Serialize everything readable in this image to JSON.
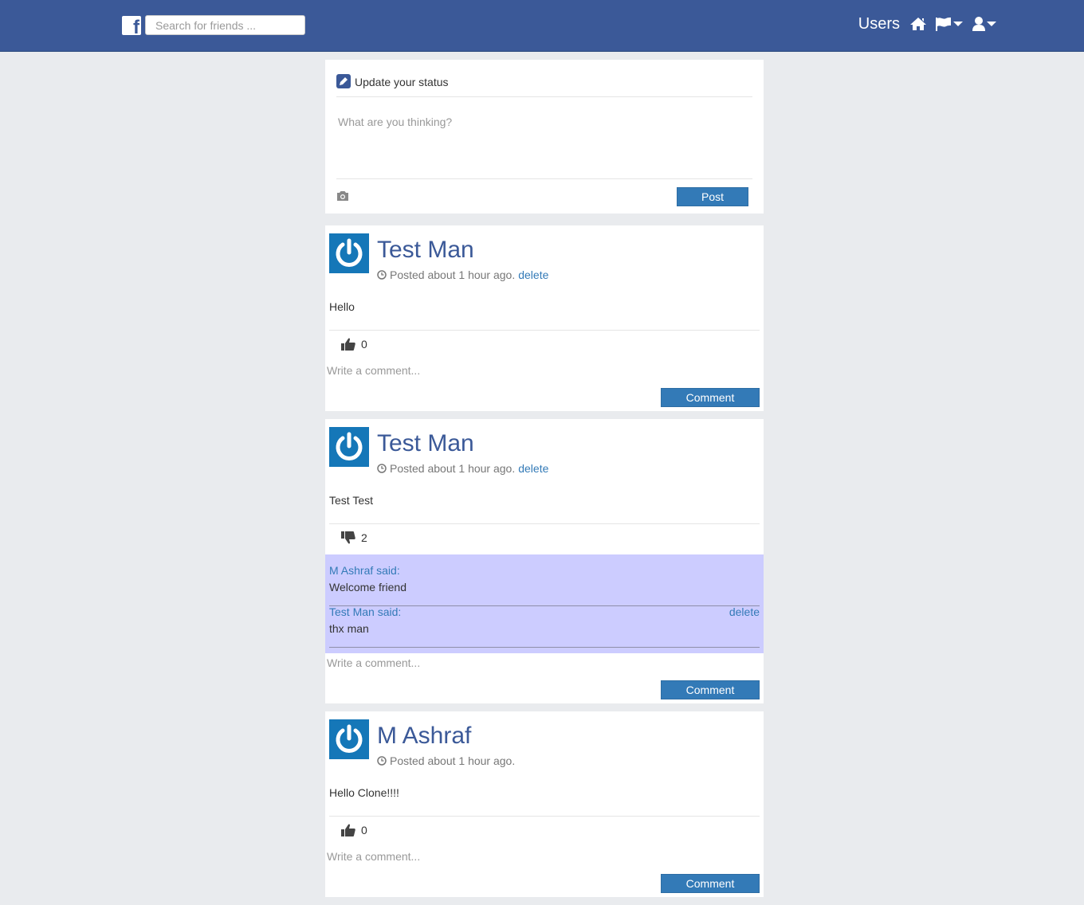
{
  "header": {
    "search_placeholder": "Search for friends ...",
    "users_label": "Users"
  },
  "composer": {
    "title": "Update your status",
    "placeholder": "What are you thinking?",
    "post_label": "Post"
  },
  "posts": [
    {
      "author": "Test Man",
      "meta": "Posted about 1 hour ago.",
      "delete_label": "delete",
      "body": "Hello",
      "reaction": "like",
      "count": "0",
      "comment_placeholder": "Write a comment...",
      "comment_button": "Comment",
      "comments": []
    },
    {
      "author": "Test Man",
      "meta": "Posted about 1 hour ago.",
      "delete_label": "delete",
      "body": "Test Test",
      "reaction": "dislike",
      "count": "2",
      "comment_placeholder": "Write a comment...",
      "comment_button": "Comment",
      "comments": [
        {
          "who": "M Ashraf said:",
          "text": "Welcome friend",
          "delete_label": ""
        },
        {
          "who": "Test Man said:",
          "text": "thx man",
          "delete_label": "delete"
        }
      ]
    },
    {
      "author": "M Ashraf",
      "meta": "Posted about 1 hour ago.",
      "delete_label": "",
      "body": "Hello Clone!!!!",
      "reaction": "like",
      "count": "0",
      "comment_placeholder": "Write a comment...",
      "comment_button": "Comment",
      "comments": []
    }
  ],
  "colors": {
    "topbar": "#3b5998",
    "accent": "#337ab7",
    "comments_bg": "#ccccff",
    "avatar": "#1577b8"
  },
  "icons": [
    "facebook-logo",
    "home-icon",
    "flag-icon",
    "user-icon",
    "caret-down-icon",
    "pencil-icon",
    "camera-icon",
    "clock-icon",
    "thumbs-up-icon",
    "thumbs-down-icon",
    "power-icon"
  ]
}
